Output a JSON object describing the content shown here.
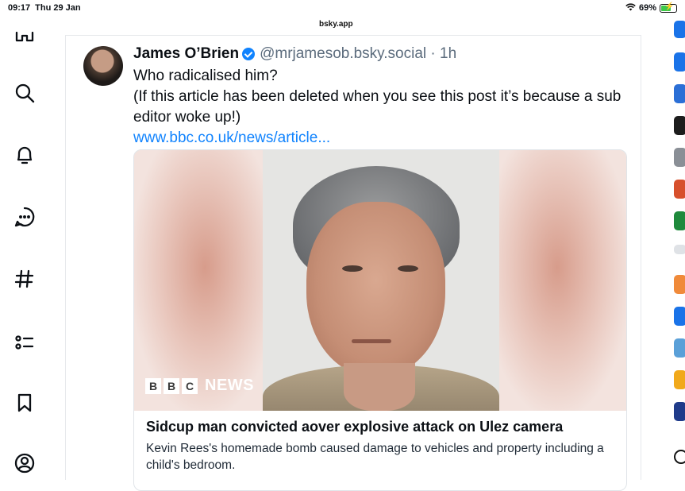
{
  "status_bar": {
    "time": "09:17",
    "date": "Thu 29 Jan",
    "battery": "69%",
    "battery_level": 0.69
  },
  "browser": {
    "url": "bsky.app"
  },
  "left_nav": {
    "items": [
      "home-icon",
      "search-icon",
      "notifications-icon",
      "chat-icon",
      "feeds-icon",
      "lists-icon",
      "saved-icon",
      "profile-icon"
    ]
  },
  "post": {
    "author_name": "James O’Brien",
    "handle": "@mrjamesob.bsky.social",
    "separator": " · ",
    "time_ago": "1h",
    "text_line1": "Who radicalised him?",
    "text_line2": "(If this article has been deleted when you see this post it’s because a sub editor woke up!)",
    "link": "www.bbc.co.uk/news/article...",
    "embed": {
      "logo_letters": [
        "B",
        "B",
        "C"
      ],
      "logo_word": "NEWS",
      "title": "Sidcup man convicted aover explosive attack on Ulez camera",
      "description": "Kevin Rees's homemade bomb caused damage to vehicles and property including a child's bedroom."
    }
  },
  "colors": {
    "accent": "#1083fe",
    "handle": "#5b6b7c",
    "battery": "#3cc94a"
  }
}
